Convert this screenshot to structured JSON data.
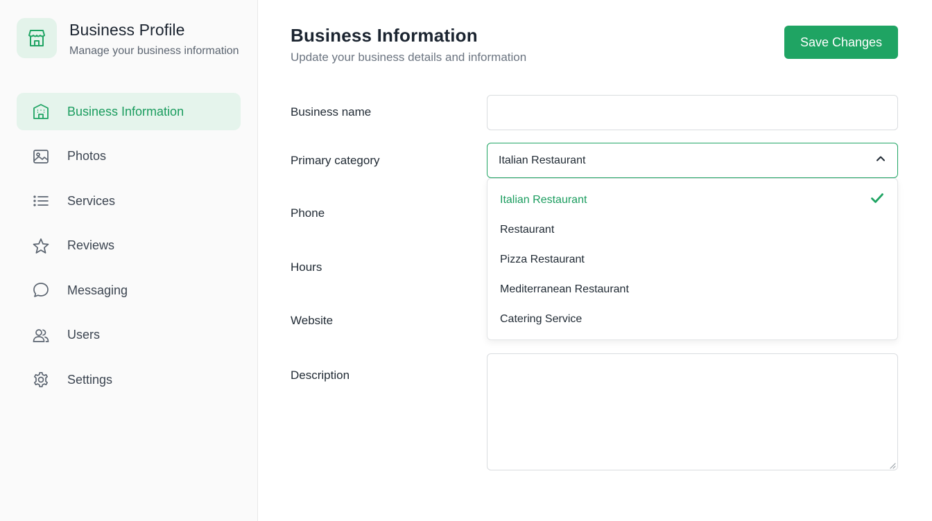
{
  "sidebar": {
    "title": "Business Profile",
    "subtitle": "Manage your business information",
    "logo_icon": "storefront-icon",
    "items": [
      {
        "label": "Business Information",
        "icon": "building-icon",
        "active": true
      },
      {
        "label": "Photos",
        "icon": "image-icon",
        "active": false
      },
      {
        "label": "Services",
        "icon": "list-icon",
        "active": false
      },
      {
        "label": "Reviews",
        "icon": "star-icon",
        "active": false
      },
      {
        "label": "Messaging",
        "icon": "chat-bubble-icon",
        "active": false
      },
      {
        "label": "Users",
        "icon": "users-icon",
        "active": false
      },
      {
        "label": "Settings",
        "icon": "gear-icon",
        "active": false
      }
    ]
  },
  "header": {
    "title": "Business Information",
    "subtitle": "Update your business details and information",
    "save_label": "Save Changes"
  },
  "form": {
    "business_name": {
      "label": "Business name",
      "value": ""
    },
    "primary_category": {
      "label": "Primary category",
      "value": "Italian Restaurant",
      "options": [
        "Italian Restaurant",
        "Restaurant",
        "Pizza Restaurant",
        "Mediterranean Restaurant",
        "Catering Service"
      ]
    },
    "phone": {
      "label": "Phone"
    },
    "hours": {
      "label": "Hours"
    },
    "website": {
      "label": "Website"
    },
    "description": {
      "label": "Description",
      "value": ""
    }
  },
  "colors": {
    "accent": "#1fa463",
    "accent_text": "#1a9c5e",
    "active_bg": "#e5f4ec"
  }
}
